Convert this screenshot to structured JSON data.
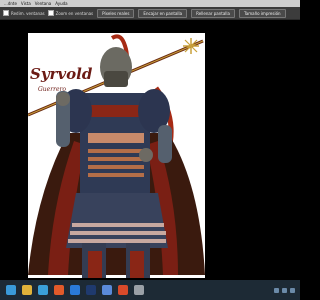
{
  "menubar": {
    "items": [
      "...dnte",
      "Vista",
      "Ventana",
      "Ayuda"
    ]
  },
  "options_bar": {
    "check1": "Redim. ventanas",
    "check2": "Zoom en ventanas",
    "buttons": [
      "Píxeles reales",
      "Encajar en pantalla",
      "Rellenar pantalla",
      "Tamaño impresión"
    ]
  },
  "document": {
    "artwork_text": "Syrvold",
    "artwork_subtext": "Guerrero"
  },
  "taskbar": {
    "apps": [
      {
        "name": "start-icon",
        "color": "#3a9ad9"
      },
      {
        "name": "file-explorer-icon",
        "color": "#e0b23a"
      },
      {
        "name": "browser-icon",
        "color": "#3aa0d9"
      },
      {
        "name": "media-icon",
        "color": "#e05a2a"
      },
      {
        "name": "app-icon",
        "color": "#2a7ad9"
      },
      {
        "name": "photoshop-icon",
        "color": "#1f3a6e"
      },
      {
        "name": "store-icon",
        "color": "#5a8ad9"
      },
      {
        "name": "chrome-icon",
        "color": "#d94a2a"
      },
      {
        "name": "settings-icon",
        "color": "#9aa0a6"
      }
    ]
  }
}
